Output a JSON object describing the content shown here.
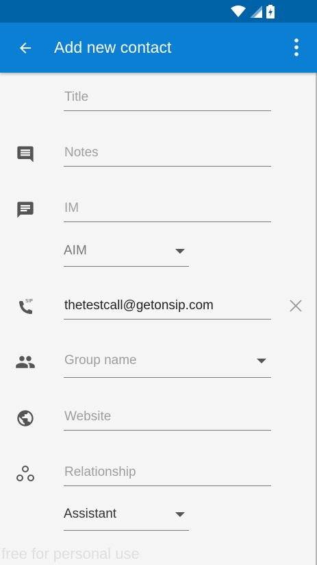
{
  "app_bar": {
    "title": "Add new contact"
  },
  "fields": {
    "title": {
      "placeholder": "Title"
    },
    "notes": {
      "placeholder": "Notes"
    },
    "im": {
      "placeholder": "IM"
    },
    "im_protocol": {
      "value": "AIM"
    },
    "sip": {
      "value": "thetestcall@getonsip.com"
    },
    "group": {
      "placeholder": "Group name"
    },
    "website": {
      "placeholder": "Website"
    },
    "relationship": {
      "placeholder": "Relationship"
    },
    "relationship_type": {
      "value": "Assistant"
    }
  },
  "icons": {
    "notes": "notes-icon",
    "im": "chat-icon",
    "sip": "sip-call-icon",
    "group": "people-icon",
    "website": "globe-icon",
    "relationship": "relationship-icon"
  },
  "colors": {
    "status_bar": "#0063a8",
    "app_bar": "#0a7fd3",
    "background": "#f5f5f5"
  },
  "watermark": "free for personal use"
}
